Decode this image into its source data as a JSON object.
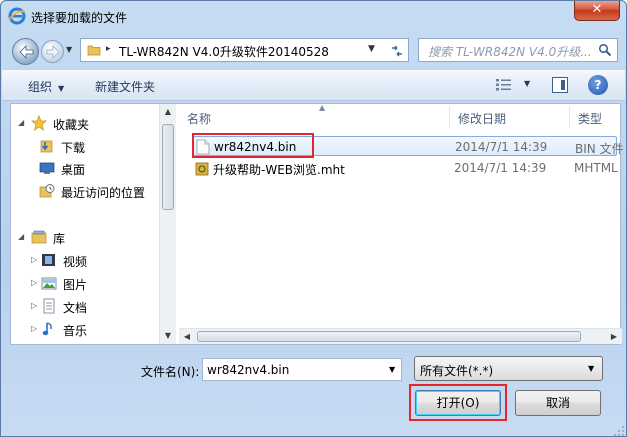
{
  "window": {
    "title": "选择要加载的文件",
    "close_label": "✕"
  },
  "address": {
    "separator": "▸",
    "path": "TL-WR842N V4.0升级软件20140528",
    "search_placeholder": "搜索 TL-WR842N V4.0升级..."
  },
  "toolbar": {
    "organize_label": "组织",
    "new_folder_label": "新建文件夹",
    "help_label": "?"
  },
  "nav_pane": {
    "favorites_label": "收藏夹",
    "items": [
      {
        "label": "下载",
        "icon": "download-folder-icon"
      },
      {
        "label": "桌面",
        "icon": "desktop-icon"
      },
      {
        "label": "最近访问的位置",
        "icon": "recent-places-icon"
      }
    ],
    "libraries_label": "库",
    "library_items": [
      {
        "label": "视频",
        "icon": "video-library-icon"
      },
      {
        "label": "图片",
        "icon": "pictures-library-icon"
      },
      {
        "label": "文档",
        "icon": "documents-library-icon"
      },
      {
        "label": "音乐",
        "icon": "music-library-icon"
      }
    ]
  },
  "file_list": {
    "columns": [
      "名称",
      "修改日期",
      "类型"
    ],
    "rows": [
      {
        "name": "wr842nv4.bin",
        "date": "2014/7/1 14:39",
        "type": "BIN 文件",
        "selected": true
      },
      {
        "name": "升级帮助-WEB浏览.mht",
        "date": "2014/7/1 14:39",
        "type": "MHTML",
        "selected": false
      }
    ]
  },
  "footer": {
    "filename_label": "文件名(N):",
    "filename_value": "wr842nv4.bin",
    "filetype_value": "所有文件(*.*)",
    "open_label": "打开(O)",
    "cancel_label": "取消"
  },
  "colors": {
    "highlight": "#e4262d",
    "selection": "#dcebfc",
    "title_bg": "#c6dcf3"
  }
}
